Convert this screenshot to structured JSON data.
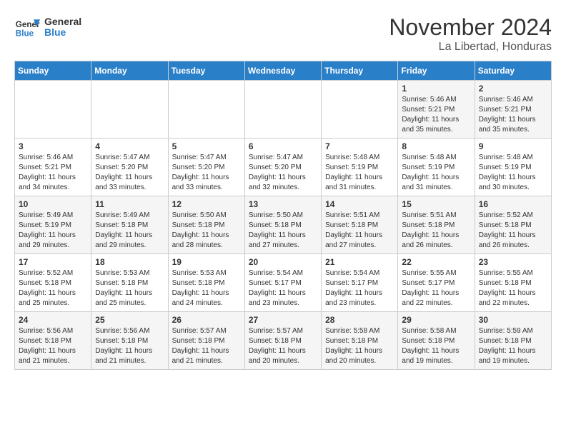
{
  "header": {
    "logo_line1": "General",
    "logo_line2": "Blue",
    "month": "November 2024",
    "location": "La Libertad, Honduras"
  },
  "weekdays": [
    "Sunday",
    "Monday",
    "Tuesday",
    "Wednesday",
    "Thursday",
    "Friday",
    "Saturday"
  ],
  "weeks": [
    [
      {
        "day": "",
        "info": ""
      },
      {
        "day": "",
        "info": ""
      },
      {
        "day": "",
        "info": ""
      },
      {
        "day": "",
        "info": ""
      },
      {
        "day": "",
        "info": ""
      },
      {
        "day": "1",
        "info": "Sunrise: 5:46 AM\nSunset: 5:21 PM\nDaylight: 11 hours\nand 35 minutes."
      },
      {
        "day": "2",
        "info": "Sunrise: 5:46 AM\nSunset: 5:21 PM\nDaylight: 11 hours\nand 35 minutes."
      }
    ],
    [
      {
        "day": "3",
        "info": "Sunrise: 5:46 AM\nSunset: 5:21 PM\nDaylight: 11 hours\nand 34 minutes."
      },
      {
        "day": "4",
        "info": "Sunrise: 5:47 AM\nSunset: 5:20 PM\nDaylight: 11 hours\nand 33 minutes."
      },
      {
        "day": "5",
        "info": "Sunrise: 5:47 AM\nSunset: 5:20 PM\nDaylight: 11 hours\nand 33 minutes."
      },
      {
        "day": "6",
        "info": "Sunrise: 5:47 AM\nSunset: 5:20 PM\nDaylight: 11 hours\nand 32 minutes."
      },
      {
        "day": "7",
        "info": "Sunrise: 5:48 AM\nSunset: 5:19 PM\nDaylight: 11 hours\nand 31 minutes."
      },
      {
        "day": "8",
        "info": "Sunrise: 5:48 AM\nSunset: 5:19 PM\nDaylight: 11 hours\nand 31 minutes."
      },
      {
        "day": "9",
        "info": "Sunrise: 5:48 AM\nSunset: 5:19 PM\nDaylight: 11 hours\nand 30 minutes."
      }
    ],
    [
      {
        "day": "10",
        "info": "Sunrise: 5:49 AM\nSunset: 5:19 PM\nDaylight: 11 hours\nand 29 minutes."
      },
      {
        "day": "11",
        "info": "Sunrise: 5:49 AM\nSunset: 5:18 PM\nDaylight: 11 hours\nand 29 minutes."
      },
      {
        "day": "12",
        "info": "Sunrise: 5:50 AM\nSunset: 5:18 PM\nDaylight: 11 hours\nand 28 minutes."
      },
      {
        "day": "13",
        "info": "Sunrise: 5:50 AM\nSunset: 5:18 PM\nDaylight: 11 hours\nand 27 minutes."
      },
      {
        "day": "14",
        "info": "Sunrise: 5:51 AM\nSunset: 5:18 PM\nDaylight: 11 hours\nand 27 minutes."
      },
      {
        "day": "15",
        "info": "Sunrise: 5:51 AM\nSunset: 5:18 PM\nDaylight: 11 hours\nand 26 minutes."
      },
      {
        "day": "16",
        "info": "Sunrise: 5:52 AM\nSunset: 5:18 PM\nDaylight: 11 hours\nand 26 minutes."
      }
    ],
    [
      {
        "day": "17",
        "info": "Sunrise: 5:52 AM\nSunset: 5:18 PM\nDaylight: 11 hours\nand 25 minutes."
      },
      {
        "day": "18",
        "info": "Sunrise: 5:53 AM\nSunset: 5:18 PM\nDaylight: 11 hours\nand 25 minutes."
      },
      {
        "day": "19",
        "info": "Sunrise: 5:53 AM\nSunset: 5:18 PM\nDaylight: 11 hours\nand 24 minutes."
      },
      {
        "day": "20",
        "info": "Sunrise: 5:54 AM\nSunset: 5:17 PM\nDaylight: 11 hours\nand 23 minutes."
      },
      {
        "day": "21",
        "info": "Sunrise: 5:54 AM\nSunset: 5:17 PM\nDaylight: 11 hours\nand 23 minutes."
      },
      {
        "day": "22",
        "info": "Sunrise: 5:55 AM\nSunset: 5:17 PM\nDaylight: 11 hours\nand 22 minutes."
      },
      {
        "day": "23",
        "info": "Sunrise: 5:55 AM\nSunset: 5:18 PM\nDaylight: 11 hours\nand 22 minutes."
      }
    ],
    [
      {
        "day": "24",
        "info": "Sunrise: 5:56 AM\nSunset: 5:18 PM\nDaylight: 11 hours\nand 21 minutes."
      },
      {
        "day": "25",
        "info": "Sunrise: 5:56 AM\nSunset: 5:18 PM\nDaylight: 11 hours\nand 21 minutes."
      },
      {
        "day": "26",
        "info": "Sunrise: 5:57 AM\nSunset: 5:18 PM\nDaylight: 11 hours\nand 21 minutes."
      },
      {
        "day": "27",
        "info": "Sunrise: 5:57 AM\nSunset: 5:18 PM\nDaylight: 11 hours\nand 20 minutes."
      },
      {
        "day": "28",
        "info": "Sunrise: 5:58 AM\nSunset: 5:18 PM\nDaylight: 11 hours\nand 20 minutes."
      },
      {
        "day": "29",
        "info": "Sunrise: 5:58 AM\nSunset: 5:18 PM\nDaylight: 11 hours\nand 19 minutes."
      },
      {
        "day": "30",
        "info": "Sunrise: 5:59 AM\nSunset: 5:18 PM\nDaylight: 11 hours\nand 19 minutes."
      }
    ]
  ]
}
